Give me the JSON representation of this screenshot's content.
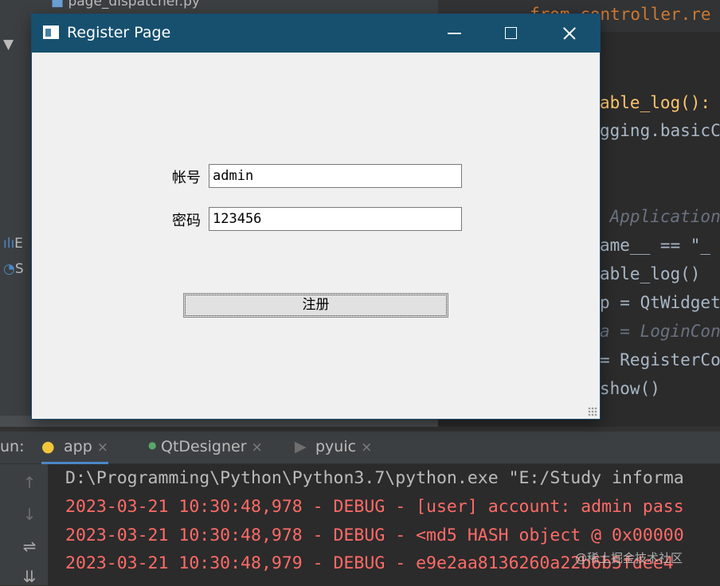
{
  "ide": {
    "project_file_partial": "page_dispatcher.py",
    "project_row_b": "E",
    "project_row_s": "S",
    "editor_tab_code": "from controller.re",
    "code_lines": {
      "l1": "able_log():",
      "l2": "gging.basicC",
      "l3": " Application",
      "l4": "ame__ == \"_",
      "l5": "able_log()",
      "l6": "p = QtWidget",
      "l7": "a = LoginCon",
      "l8": "= RegisterCo",
      "l9": "show()"
    }
  },
  "run_panel": {
    "label": "un:",
    "tabs": [
      {
        "label": "app",
        "icon": "python-icon"
      },
      {
        "label": "QtDesigner",
        "icon": "green-dot-icon"
      },
      {
        "label": "pyuic",
        "icon": "run-icon"
      }
    ],
    "close_glyph": "×",
    "console_lines": [
      "D:\\Programming\\Python\\Python3.7\\python.exe \"E:/Study informa",
      "2023-03-21 10:30:48,978 - DEBUG - [user] account: admin pass",
      "2023-03-21 10:30:48,978 - DEBUG - <md5 HASH object @ 0x00000",
      "2023-03-21 10:30:48,979 - DEBUG - e9e2aa8136260a22b6b5fdee4"
    ],
    "watermark": "@稀土掘金技术社区"
  },
  "dialog": {
    "title": "Register Page",
    "account_label": "帐号",
    "account_value": "admin",
    "password_label": "密码",
    "password_value": "123456",
    "register_button": "注册"
  },
  "colors": {
    "titlebar": "#17506f",
    "console_error": "#ff6b68",
    "dialog_bg": "#f0f0f0"
  }
}
